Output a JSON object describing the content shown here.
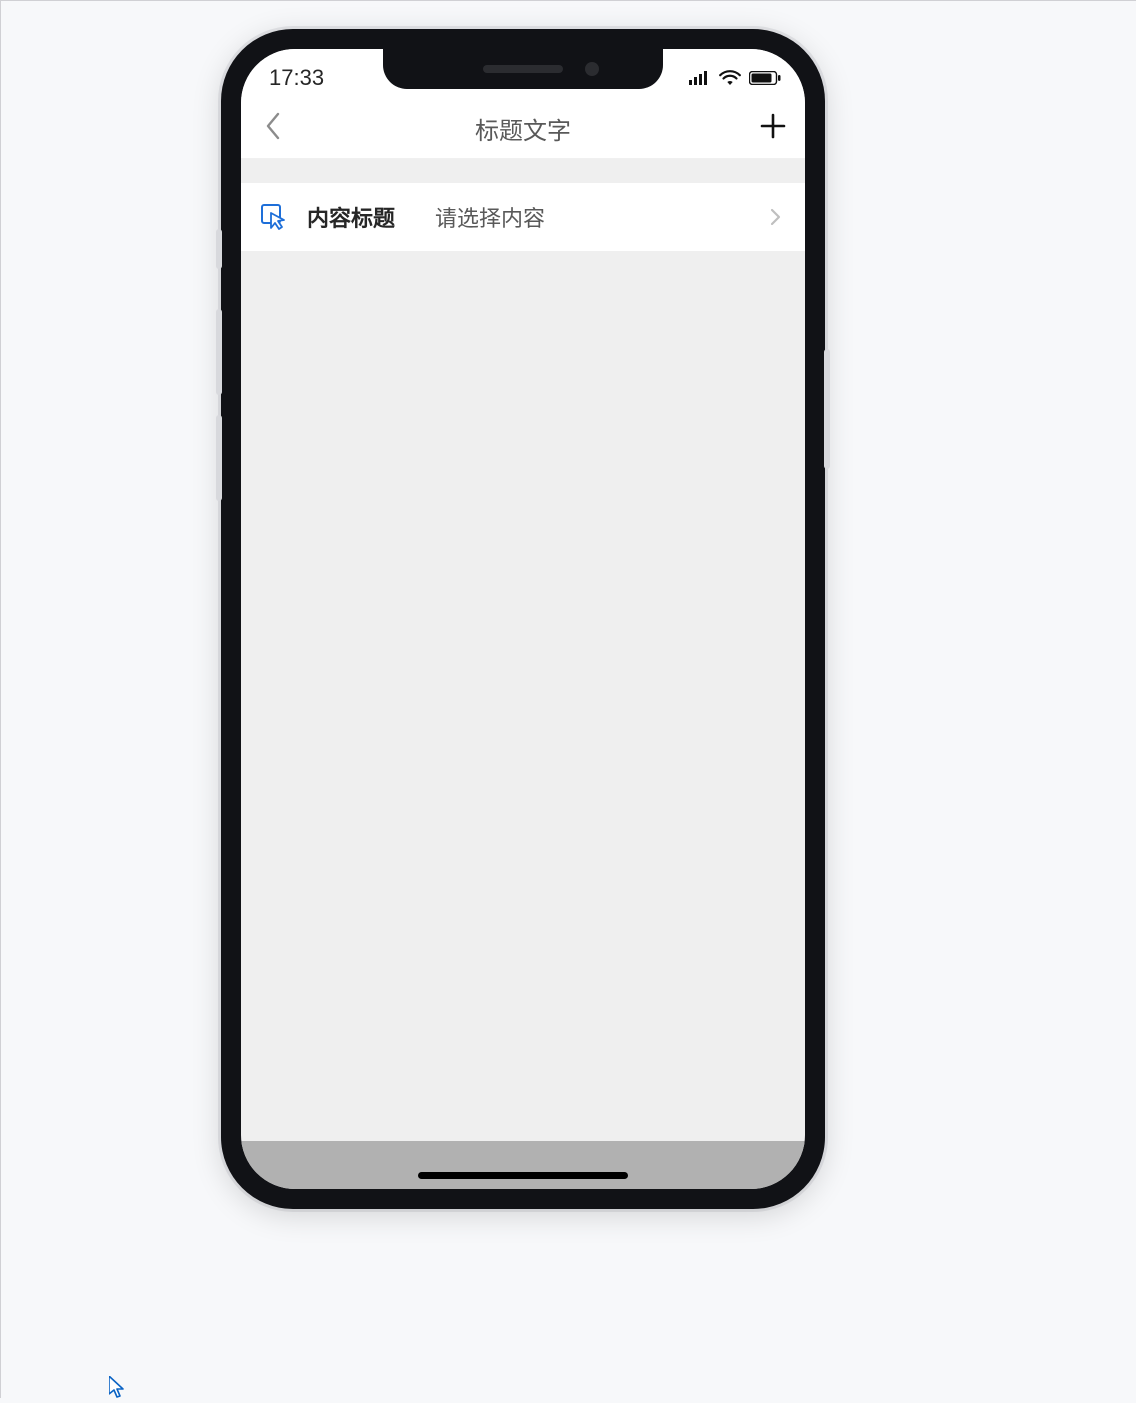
{
  "status": {
    "time": "17:33"
  },
  "nav": {
    "title": "标题文字"
  },
  "cell": {
    "label": "内容标题",
    "placeholder": "请选择内容"
  }
}
